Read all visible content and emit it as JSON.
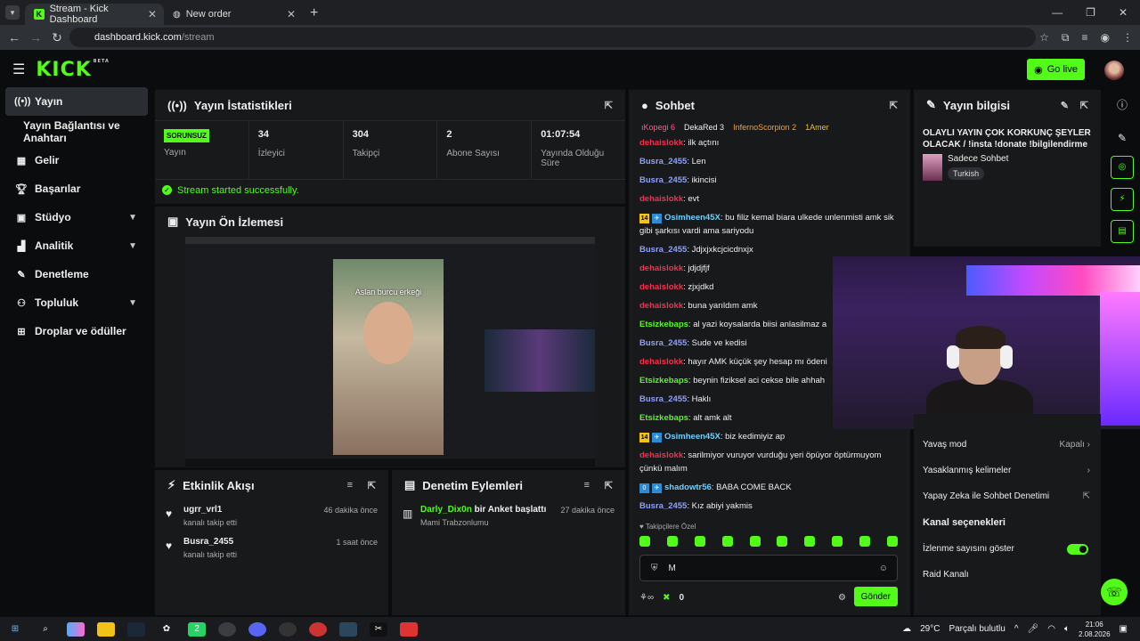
{
  "browser": {
    "tab_active": "Stream - Kick Dashboard",
    "tab_inactive": "New order",
    "url_host": "dashboard.kick.com",
    "url_path": "/stream"
  },
  "topbar": {
    "logo": "KICK",
    "beta": "BETA",
    "go_live": "Go live"
  },
  "sidebar": {
    "items": [
      {
        "label": "Yayın",
        "icon": "broadcast-icon"
      },
      {
        "label": "Yayın Bağlantısı ve Anahtarı"
      },
      {
        "label": "Gelir",
        "icon": "revenue-icon"
      },
      {
        "label": "Başarılar",
        "icon": "trophy-icon"
      },
      {
        "label": "Stüdyo",
        "icon": "studio-icon"
      },
      {
        "label": "Analitik",
        "icon": "chart-icon"
      },
      {
        "label": "Denetleme",
        "icon": "wrench-icon"
      },
      {
        "label": "Topluluk",
        "icon": "community-icon"
      },
      {
        "label": "Droplar ve ödüller",
        "icon": "gift-icon"
      }
    ]
  },
  "stats": {
    "title": "Yayın İstatistikleri",
    "offline_badge": "SORUNSUZ",
    "cells": [
      {
        "value": "",
        "label": "Yayın"
      },
      {
        "value": "34",
        "label": "İzleyici"
      },
      {
        "value": "304",
        "label": "Takipçi"
      },
      {
        "value": "2",
        "label": "Abone Sayısı"
      },
      {
        "value": "01:07:54",
        "label": "Yayında Olduğu Süre"
      }
    ],
    "success": "Stream started successfully."
  },
  "preview": {
    "title": "Yayın Ön İzlemesi",
    "caption": "Aslan burcu erkeği"
  },
  "chat": {
    "title": "Sohbet",
    "top_users": [
      "ıKopegi 6",
      "DekaRed 3",
      "InfernoScorpion 2",
      "1Amer"
    ],
    "messages": [
      {
        "user": "dehaislokk",
        "color": "red",
        "text": "ilk açtını"
      },
      {
        "user": "Busra_2455",
        "color": "blue",
        "text": "Len"
      },
      {
        "user": "Busra_2455",
        "color": "blue",
        "text": "ikincisi"
      },
      {
        "user": "dehaislokk",
        "color": "red",
        "text": "evt"
      },
      {
        "user": "Osimheen45X",
        "color": "cyan",
        "badge": "14",
        "text": "bu filiz kemal biara ulkede unlenmisti amk sik gibi şarkısı vardi ama sariyodu"
      },
      {
        "user": "Busra_2455",
        "color": "blue",
        "text": "Jdjxjxkcjcicdnxjx"
      },
      {
        "user": "dehaislokk",
        "color": "red",
        "text": "jdjdjfjf"
      },
      {
        "user": "dehaislokk",
        "color": "red",
        "text": "zjxjdkd"
      },
      {
        "user": "dehaislokk",
        "color": "red",
        "text": "buna yarıldım amk"
      },
      {
        "user": "Etsizkebaps",
        "color": "green",
        "text": "al yazi koysalarda biisi anlasilmaz a"
      },
      {
        "user": "Busra_2455",
        "color": "blue",
        "text": "Sude ve kedisi"
      },
      {
        "user": "dehaislokk",
        "color": "red",
        "text": "hayır AMK küçük şey hesap mı ödeni"
      },
      {
        "user": "Etsizkebaps",
        "color": "green",
        "text": "beynin fiziksel aci cekse bile ahhah"
      },
      {
        "user": "Busra_2455",
        "color": "blue",
        "text": "Haklı"
      },
      {
        "user": "Etsizkebaps",
        "color": "green",
        "text": "alt amk alt"
      },
      {
        "user": "Osimheen45X",
        "color": "cyan",
        "badge": "14",
        "text": "biz kedimiyiz ap"
      },
      {
        "user": "dehaislokk",
        "color": "red",
        "text": "sarilmiyor vuruyor vurduğu yeri öpüyor öptürmuyom çünkü malım"
      },
      {
        "user": "shadowtr56",
        "color": "cyan",
        "badge": "0",
        "text": "BABA COME BACK"
      },
      {
        "user": "Busra_2455",
        "color": "blue",
        "text": "Kız abiyi yakmis"
      }
    ],
    "followers_only": "Takipçilere Özel",
    "input_value": "M",
    "viewer_count": "0",
    "send": "Gönder"
  },
  "stream_info": {
    "title": "Yayın bilgisi",
    "stream_title": "OLAYLI YAYIN ÇOK KORKUNÇ ŞEYLER OLACAK / !insta !donate !bilgilendirme",
    "category": "Sadece Sohbet",
    "tag": "Turkish"
  },
  "chat_settings": {
    "rows": [
      {
        "label": "Yavaş mod",
        "value": "Kapalı"
      },
      {
        "label": "Yasaklanmış kelimeler",
        "value": ""
      },
      {
        "label": "Yapay Zeka ile Sohbet Denetimi",
        "value": ""
      }
    ],
    "channel_options_title": "Kanal seçenekleri",
    "show_views": "İzlenme sayısını göster",
    "raid": "Raid Kanalı"
  },
  "events": {
    "title": "Etkinlik Akışı",
    "items": [
      {
        "name": "ugrr_vrl1",
        "sub": "kanalı takip etti",
        "time": "46 dakika önce"
      },
      {
        "name": "Busra_2455",
        "sub": "kanalı takip etti",
        "time": "1 saat önce"
      }
    ]
  },
  "moderation": {
    "title": "Denetim Eylemleri",
    "items": [
      {
        "user": "Darly_Dix0n",
        "action": "bir Anket başlattı",
        "sub": "Mami Trabzonlumu",
        "time": "27 dakika önce"
      }
    ]
  },
  "taskbar": {
    "weather_temp": "29°C",
    "weather_text": "Parçalı bulutlu",
    "time": "21:06",
    "date": "2.08.2026"
  },
  "colors": {
    "accent": "#53fc18",
    "bg": "#0b0c0d",
    "panel": "#18191b"
  }
}
